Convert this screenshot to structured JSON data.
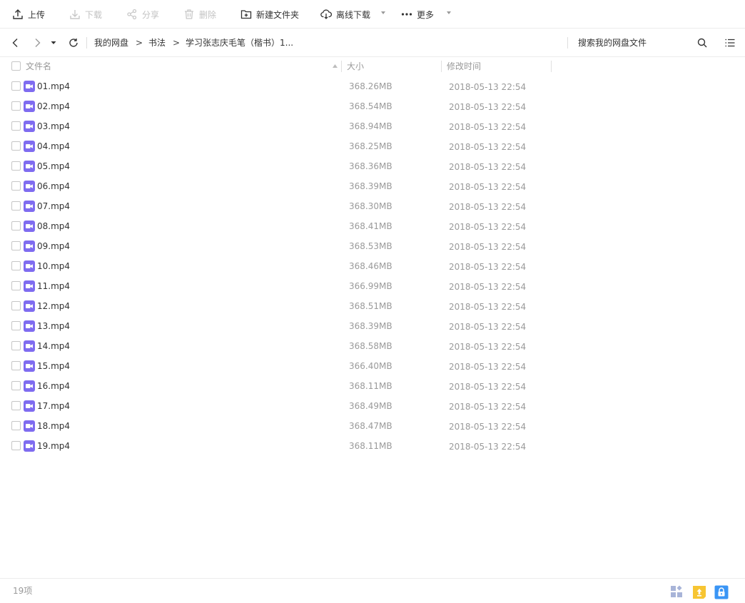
{
  "toolbar": {
    "upload": "上传",
    "download": "下载",
    "share": "分享",
    "delete": "删除",
    "new_folder": "新建文件夹",
    "offline_download": "离线下载",
    "more": "更多"
  },
  "nav": {
    "breadcrumb": [
      "我的网盘",
      "书法",
      "学习张志庆毛笔（楷书）1..."
    ],
    "separator": ">",
    "search_placeholder": "搜索我的网盘文件"
  },
  "columns": {
    "name": "文件名",
    "size": "大小",
    "modified": "修改时间"
  },
  "files": [
    {
      "name": "01.mp4",
      "size": "368.26MB",
      "modified": "2018-05-13 22:54"
    },
    {
      "name": "02.mp4",
      "size": "368.54MB",
      "modified": "2018-05-13 22:54"
    },
    {
      "name": "03.mp4",
      "size": "368.94MB",
      "modified": "2018-05-13 22:54"
    },
    {
      "name": "04.mp4",
      "size": "368.25MB",
      "modified": "2018-05-13 22:54"
    },
    {
      "name": "05.mp4",
      "size": "368.36MB",
      "modified": "2018-05-13 22:54"
    },
    {
      "name": "06.mp4",
      "size": "368.39MB",
      "modified": "2018-05-13 22:54"
    },
    {
      "name": "07.mp4",
      "size": "368.30MB",
      "modified": "2018-05-13 22:54"
    },
    {
      "name": "08.mp4",
      "size": "368.41MB",
      "modified": "2018-05-13 22:54"
    },
    {
      "name": "09.mp4",
      "size": "368.53MB",
      "modified": "2018-05-13 22:54"
    },
    {
      "name": "10.mp4",
      "size": "368.46MB",
      "modified": "2018-05-13 22:54"
    },
    {
      "name": "11.mp4",
      "size": "366.99MB",
      "modified": "2018-05-13 22:54"
    },
    {
      "name": "12.mp4",
      "size": "368.51MB",
      "modified": "2018-05-13 22:54"
    },
    {
      "name": "13.mp4",
      "size": "368.39MB",
      "modified": "2018-05-13 22:54"
    },
    {
      "name": "14.mp4",
      "size": "368.58MB",
      "modified": "2018-05-13 22:54"
    },
    {
      "name": "15.mp4",
      "size": "366.40MB",
      "modified": "2018-05-13 22:54"
    },
    {
      "name": "16.mp4",
      "size": "368.11MB",
      "modified": "2018-05-13 22:54"
    },
    {
      "name": "17.mp4",
      "size": "368.49MB",
      "modified": "2018-05-13 22:54"
    },
    {
      "name": "18.mp4",
      "size": "368.47MB",
      "modified": "2018-05-13 22:54"
    },
    {
      "name": "19.mp4",
      "size": "368.11MB",
      "modified": "2018-05-13 22:54"
    }
  ],
  "status": {
    "count": "19项"
  },
  "icons": {
    "file": "video-file-icon",
    "status_bar": [
      "grid-view-icon",
      "upload-task-icon",
      "lock-icon"
    ]
  },
  "colors": {
    "video_icon": "#7f6cf0",
    "upload_badge": "#f7c532",
    "lock_badge": "#3a95f5",
    "grid_icon": "#a8b4d8"
  }
}
